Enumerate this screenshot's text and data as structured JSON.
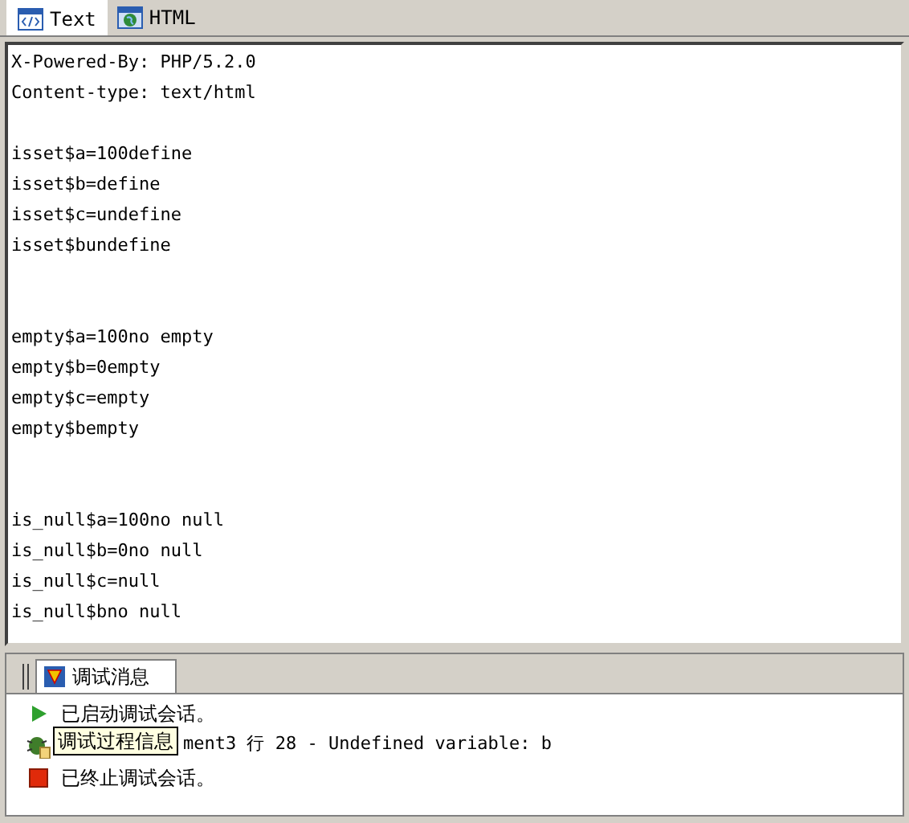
{
  "tabs": [
    {
      "label": "Text",
      "kind": "text",
      "selected": true
    },
    {
      "label": "HTML",
      "kind": "html",
      "selected": false
    }
  ],
  "output": "X-Powered-By: PHP/5.2.0\nContent-type: text/html\n\nisset$a=100define\nisset$b=define\nisset$c=undefine\nisset$bundefine\n\n\nempty$a=100no empty\nempty$b=0empty\nempty$c=empty\nempty$bempty\n\n\nis_null$a=100no null\nis_null$b=0no null\nis_null$c=null\nis_null$bno null",
  "debug_panel": {
    "tab": "调试消息",
    "messages": [
      {
        "kind": "start",
        "text": "已启动调试会话。"
      },
      {
        "kind": "error",
        "text": "ment3 行 28 - Undefined variable: b"
      },
      {
        "kind": "stop",
        "text": "已终止调试会话。"
      }
    ],
    "tooltip": "调试过程信息"
  }
}
